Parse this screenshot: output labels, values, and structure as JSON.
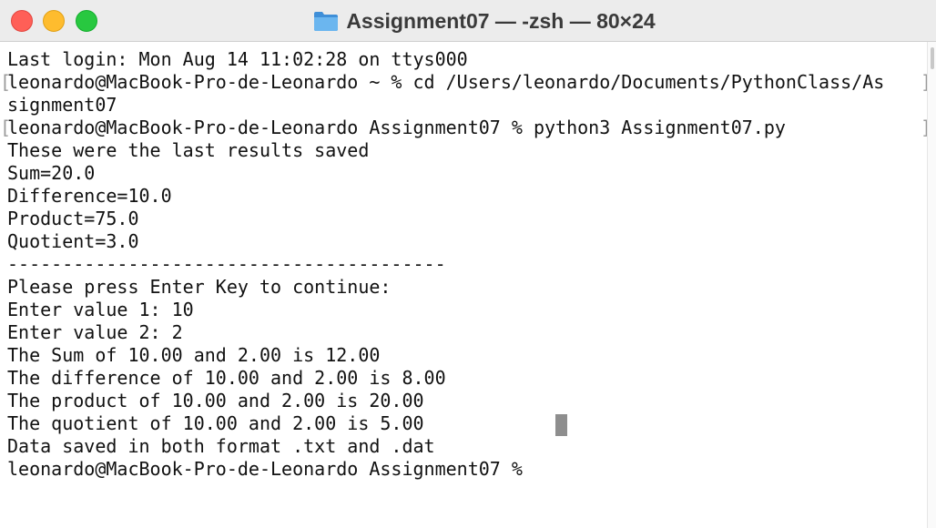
{
  "window": {
    "title": "Assignment07 — -zsh — 80×24",
    "title_icon": "folder-icon",
    "controls": {
      "close": "close-button",
      "minimize": "minimize-button",
      "zoom": "zoom-button"
    },
    "colors": {
      "close": "#ff5f57",
      "minimize": "#febc2e",
      "zoom": "#28c840",
      "folder": "#5aa9e6",
      "cursor": "#8e8e8e"
    }
  },
  "terminal": {
    "lines": [
      "Last login: Mon Aug 14 11:02:28 on ttys000",
      "leonardo@MacBook-Pro-de-Leonardo ~ % cd /Users/leonardo/Documents/PythonClass/As",
      "signment07",
      "leonardo@MacBook-Pro-de-Leonardo Assignment07 % python3 Assignment07.py",
      "These were the last results saved",
      "Sum=20.0",
      "Difference=10.0",
      "Product=75.0",
      "Quotient=3.0",
      "----------------------------------------",
      "Please press Enter Key to continue:",
      "Enter value 1: 10",
      "Enter value 2: 2",
      "The Sum of 10.00 and 2.00 is 12.00",
      "The difference of 10.00 and 2.00 is 8.00",
      "The product of 10.00 and 2.00 is 20.00",
      "The quotient of 10.00 and 2.00 is 5.00",
      "Data saved in both format .txt and .dat",
      "leonardo@MacBook-Pro-de-Leonardo Assignment07 % "
    ]
  }
}
